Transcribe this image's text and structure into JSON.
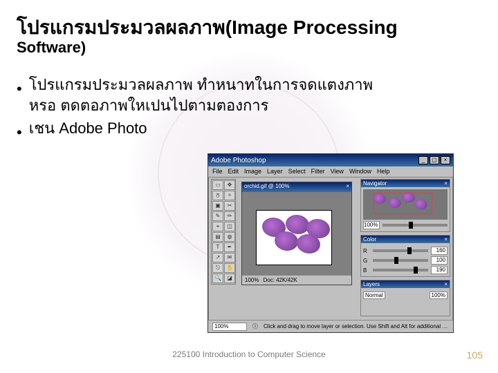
{
  "slide": {
    "title": "โปรแกรมประมวลผลภาพ(Image Processing",
    "subtitle": "Software)",
    "bullets": [
      "โปรแกรมประมวลผลภาพ ทำหนาทในการจดแตงภาพ       หรอ ตดตอภาพใหเปนไปตามตองการ",
      "เชน   Adobe Photo"
    ],
    "footer": "225100 Introduction to Computer Science",
    "page": "105"
  },
  "photoshop": {
    "title": "Adobe Photoshop",
    "menu": [
      "File",
      "Edit",
      "Image",
      "Layer",
      "Select",
      "Filter",
      "View",
      "Window",
      "Help"
    ],
    "doc_title": "orchid.gif @ 100%",
    "zoom": "100%",
    "status_hint": "Click and drag to move layer or selection. Use Shift and Alt for additional options.",
    "doc_label": "Doc: 42K/42K",
    "nav": {
      "label": "Navigator",
      "percent": "100%"
    },
    "color": {
      "label": "Color",
      "R": "160",
      "G": "100",
      "B": "190"
    },
    "layers": {
      "label": "Layers",
      "mode": "Normal",
      "opacity": "100%"
    }
  }
}
